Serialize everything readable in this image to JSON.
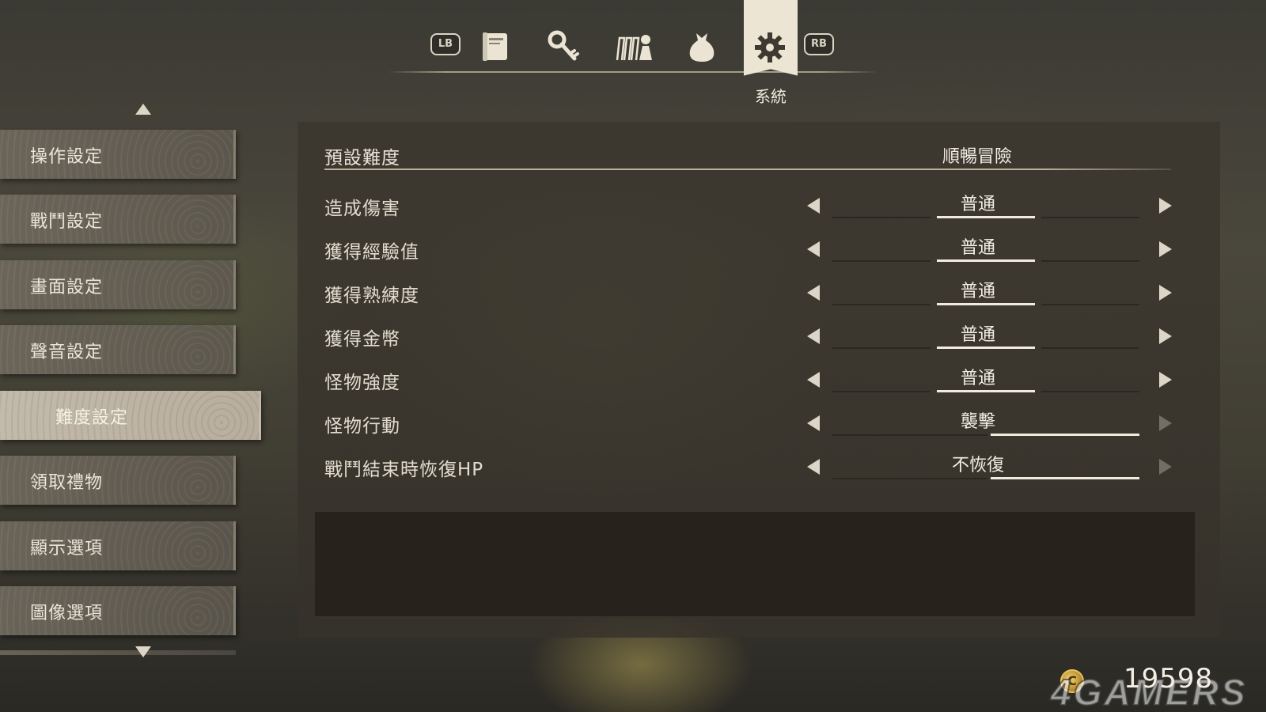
{
  "top_tabs": {
    "lb_label": "LB",
    "rb_label": "RB",
    "icons": [
      "book-icon",
      "key-icon",
      "party-icon",
      "bag-icon",
      "gear-icon"
    ],
    "active_label": "系統"
  },
  "sidebar": {
    "items": [
      {
        "label": "操作設定"
      },
      {
        "label": "戰鬥設定"
      },
      {
        "label": "畫面設定"
      },
      {
        "label": "聲音設定"
      },
      {
        "label": "難度設定",
        "active": true
      },
      {
        "label": "領取禮物"
      },
      {
        "label": "顯示選項"
      },
      {
        "label": "圖像選項"
      }
    ]
  },
  "preset": {
    "label": "預設難度",
    "value": "順暢冒險"
  },
  "options": [
    {
      "label": "造成傷害",
      "value": "普通",
      "level": 2,
      "levels": 3
    },
    {
      "label": "獲得經驗值",
      "value": "普通",
      "level": 2,
      "levels": 3
    },
    {
      "label": "獲得熟練度",
      "value": "普通",
      "level": 2,
      "levels": 3
    },
    {
      "label": "獲得金幣",
      "value": "普通",
      "level": 2,
      "levels": 3
    },
    {
      "label": "怪物強度",
      "value": "普通",
      "level": 2,
      "levels": 3
    },
    {
      "label": "怪物行動",
      "value": "襲擊",
      "level": 2,
      "levels": 2
    },
    {
      "label": "戰鬥結束時恢復HP",
      "value": "不恢復",
      "level": 2,
      "levels": 2
    }
  ],
  "currency": {
    "amount": "19598",
    "symbol": "C"
  },
  "watermark": "4GAMERS",
  "colors": {
    "accent": "#ede5d3",
    "panel": "#3a362e",
    "coin": "#d9a93a"
  }
}
